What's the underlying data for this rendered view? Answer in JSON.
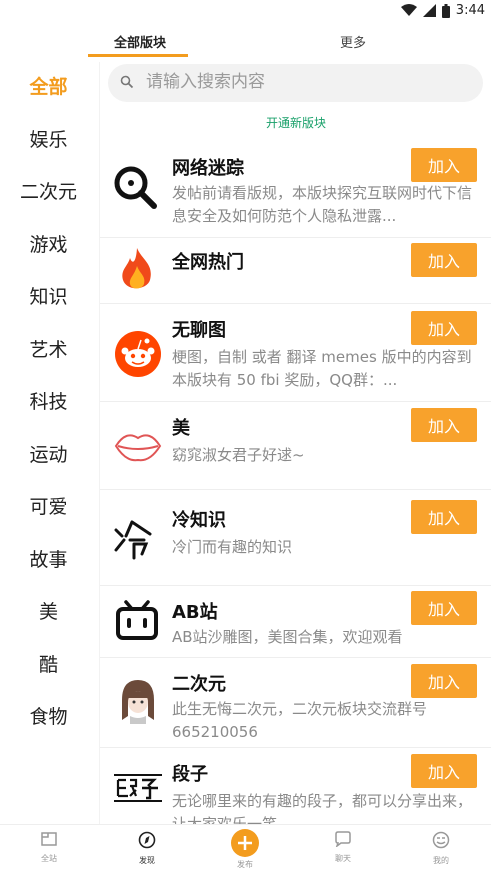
{
  "status": {
    "time": "3:44"
  },
  "tabs": {
    "all": "全部版块",
    "more": "更多"
  },
  "sidebar": {
    "items": [
      "全部",
      "娱乐",
      "二次元",
      "游戏",
      "知识",
      "艺术",
      "科技",
      "运动",
      "可爱",
      "故事",
      "美",
      "酷",
      "食物"
    ]
  },
  "search": {
    "placeholder": "请输入搜索内容"
  },
  "open_link": "开通新版块",
  "join_label": "加入",
  "rows": [
    {
      "title": "网络迷踪",
      "desc": "发帖前请看版规，本版块探究互联网时代下信息安全及如何防范个人隐私泄露...",
      "icon": "magnifier-icon"
    },
    {
      "title": "全网热门",
      "desc": "",
      "icon": "fire-icon"
    },
    {
      "title": "无聊图",
      "desc": "梗图，自制 或者 翻译 memes 版中的内容到本版块有 50 fbi 奖励，QQ群：...",
      "icon": "reddit-icon"
    },
    {
      "title": "美",
      "desc": "窈窕淑女君子好逑~",
      "icon": "lips-icon"
    },
    {
      "title": "冷知识",
      "desc": "冷门而有趣的知识",
      "icon": "leng-calligraphy-icon"
    },
    {
      "title": "AB站",
      "desc": "AB站沙雕图，美图合集，欢迎观看",
      "icon": "tv-icon"
    },
    {
      "title": "二次元",
      "desc": "此生无悔二次元，二次元板块交流群号665210056",
      "icon": "anime-girl-icon"
    },
    {
      "title": "段子",
      "desc": "无论哪里来的有趣的段子，都可以分享出来，让大家欢乐一笑",
      "icon": "duanzi-text-icon"
    }
  ],
  "bottom_nav": {
    "items": [
      {
        "label": "全站",
        "icon": "home-icon"
      },
      {
        "label": "发现",
        "icon": "compass-icon"
      },
      {
        "label": "发布",
        "icon": "plus-icon"
      },
      {
        "label": "聊天",
        "icon": "chat-icon"
      },
      {
        "label": "我的",
        "icon": "profile-icon"
      }
    ]
  },
  "colors": {
    "accent": "#f39c1e",
    "button": "#f8a22c",
    "link": "#19a06a"
  }
}
